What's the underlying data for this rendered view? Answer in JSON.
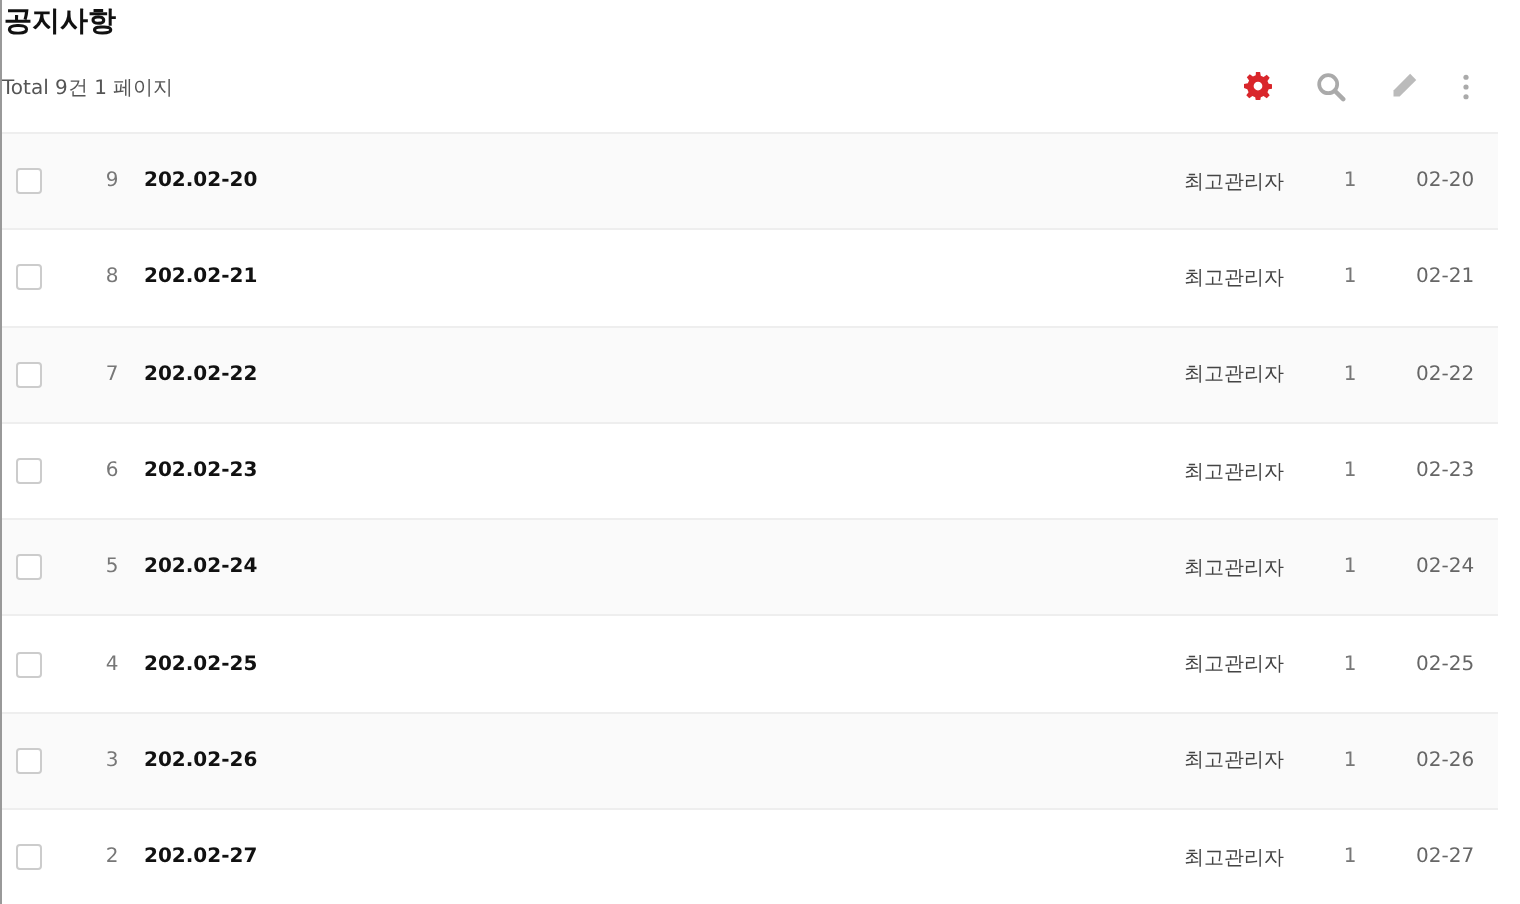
{
  "page_title": "공지사항",
  "summary": "Total 9건 1 페이지",
  "rows": [
    {
      "checked": false,
      "number": "9",
      "title": "202.02-20",
      "author": "최고관리자",
      "views": "1",
      "date": "02-20"
    },
    {
      "checked": false,
      "number": "8",
      "title": "202.02-21",
      "author": "최고관리자",
      "views": "1",
      "date": "02-21"
    },
    {
      "checked": false,
      "number": "7",
      "title": "202.02-22",
      "author": "최고관리자",
      "views": "1",
      "date": "02-22"
    },
    {
      "checked": false,
      "number": "6",
      "title": "202.02-23",
      "author": "최고관리자",
      "views": "1",
      "date": "02-23"
    },
    {
      "checked": false,
      "number": "5",
      "title": "202.02-24",
      "author": "최고관리자",
      "views": "1",
      "date": "02-24"
    },
    {
      "checked": false,
      "number": "4",
      "title": "202.02-25",
      "author": "최고관리자",
      "views": "1",
      "date": "02-25"
    },
    {
      "checked": false,
      "number": "3",
      "title": "202.02-26",
      "author": "최고관리자",
      "views": "1",
      "date": "02-26"
    },
    {
      "checked": false,
      "number": "2",
      "title": "202.02-27",
      "author": "최고관리자",
      "views": "1",
      "date": "02-27"
    }
  ]
}
